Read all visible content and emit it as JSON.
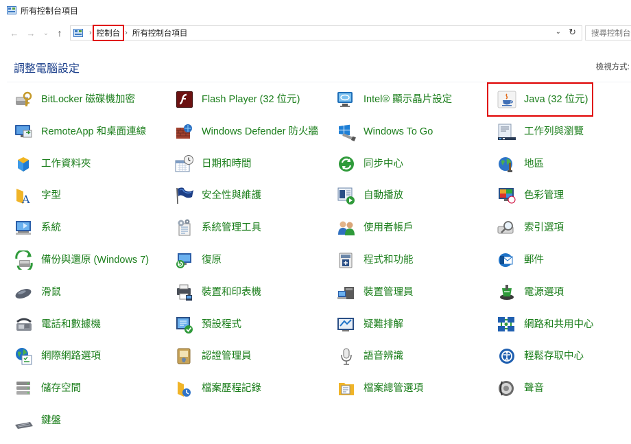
{
  "window": {
    "title": "所有控制台項目"
  },
  "nav": {
    "back": "←",
    "forward": "→",
    "recent": "⌄",
    "up": "↑"
  },
  "address": {
    "crumbs": [
      "控制台",
      "所有控制台項目"
    ],
    "separator": "›",
    "dropdown": "⌄",
    "refresh": "↻"
  },
  "search": {
    "placeholder": "搜尋控制台"
  },
  "header": {
    "title": "調整電腦設定",
    "view_by": "檢視方式:"
  },
  "items": [
    {
      "label": "BitLocker 磁碟機加密",
      "icon": "bitlocker-icon"
    },
    {
      "label": "Flash Player (32 位元)",
      "icon": "flash-icon"
    },
    {
      "label": "Intel® 顯示晶片設定",
      "icon": "intel-graphics-icon"
    },
    {
      "label": "Java (32 位元)",
      "icon": "java-icon"
    },
    {
      "label": "RemoteApp 和桌面連線",
      "icon": "remoteapp-icon"
    },
    {
      "label": "Windows Defender 防火牆",
      "icon": "firewall-icon"
    },
    {
      "label": "Windows To Go",
      "icon": "windows-to-go-icon"
    },
    {
      "label": "工作列與瀏覽",
      "icon": "taskbar-icon"
    },
    {
      "label": "工作資料夾",
      "icon": "work-folders-icon"
    },
    {
      "label": "日期和時間",
      "icon": "date-time-icon"
    },
    {
      "label": "同步中心",
      "icon": "sync-icon"
    },
    {
      "label": "地區",
      "icon": "region-icon"
    },
    {
      "label": "字型",
      "icon": "fonts-icon"
    },
    {
      "label": "安全性與維護",
      "icon": "security-flag-icon"
    },
    {
      "label": "自動播放",
      "icon": "autoplay-icon"
    },
    {
      "label": "色彩管理",
      "icon": "color-management-icon"
    },
    {
      "label": "系統",
      "icon": "system-icon"
    },
    {
      "label": "系統管理工具",
      "icon": "admin-tools-icon"
    },
    {
      "label": "使用者帳戶",
      "icon": "user-accounts-icon"
    },
    {
      "label": "索引選項",
      "icon": "indexing-icon"
    },
    {
      "label": "備份與還原 (Windows 7)",
      "icon": "backup-icon"
    },
    {
      "label": "復原",
      "icon": "recovery-icon"
    },
    {
      "label": "程式和功能",
      "icon": "programs-icon"
    },
    {
      "label": "郵件",
      "icon": "mail-icon"
    },
    {
      "label": "滑鼠",
      "icon": "mouse-icon"
    },
    {
      "label": "裝置和印表機",
      "icon": "printer-icon"
    },
    {
      "label": "裝置管理員",
      "icon": "device-manager-icon"
    },
    {
      "label": "電源選項",
      "icon": "power-icon"
    },
    {
      "label": "電話和數據機",
      "icon": "phone-modem-icon"
    },
    {
      "label": "預設程式",
      "icon": "default-programs-icon"
    },
    {
      "label": "疑難排解",
      "icon": "troubleshooting-icon"
    },
    {
      "label": "網路和共用中心",
      "icon": "network-icon"
    },
    {
      "label": "網際網路選項",
      "icon": "internet-options-icon"
    },
    {
      "label": "認證管理員",
      "icon": "credential-icon"
    },
    {
      "label": "語音辨識",
      "icon": "microphone-icon"
    },
    {
      "label": "輕鬆存取中心",
      "icon": "ease-of-access-icon"
    },
    {
      "label": "儲存空間",
      "icon": "storage-spaces-icon"
    },
    {
      "label": "檔案歷程記錄",
      "icon": "file-history-icon"
    },
    {
      "label": "檔案總管選項",
      "icon": "explorer-options-icon"
    },
    {
      "label": "聲音",
      "icon": "sound-icon"
    },
    {
      "label": "鍵盤",
      "icon": "keyboard-icon"
    }
  ],
  "colors": {
    "link": "#1b7e1b",
    "heading": "#1a3e8a",
    "highlight": "#e00000"
  }
}
